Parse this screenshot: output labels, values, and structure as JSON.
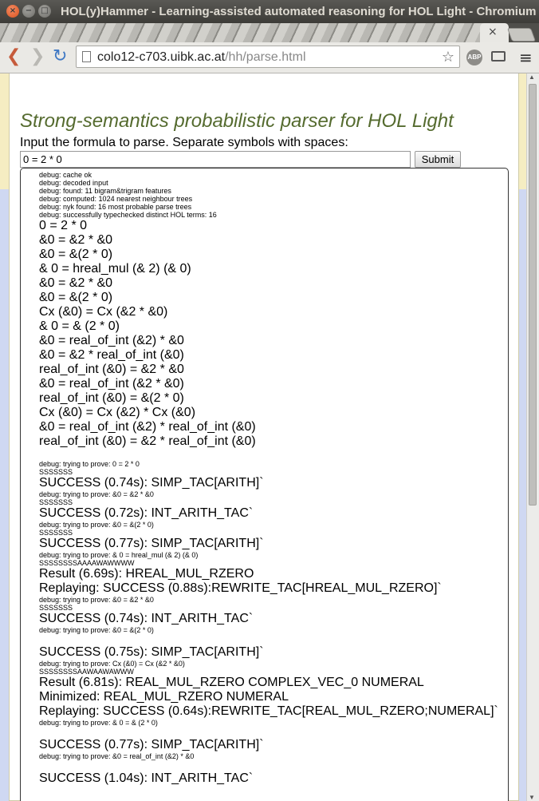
{
  "window": {
    "title": "HOL(y)Hammer - Learning-assisted automated reasoning for HOL Light - Chromium"
  },
  "tab": {
    "close_glyph": "×"
  },
  "toolbar": {
    "back_glyph": "❮",
    "forward_glyph": "❯",
    "reload_glyph": "↻",
    "url_host": "colo12-c703.uibk.ac.at",
    "url_path": "/hh/parse.html",
    "star_glyph": "☆",
    "abp_label": "ABP",
    "menu_glyph": "≡"
  },
  "page": {
    "heading": "Strong-semantics probabilistic parser for HOL Light",
    "instructions": "Input the formula to parse. Separate symbols with spaces:",
    "input_value": "0 = 2 * 0",
    "submit_label": "Submit"
  },
  "output_lines": [
    {
      "t": "debug: cache ok",
      "k": "dbg"
    },
    {
      "t": "debug: decoded input",
      "k": "dbg"
    },
    {
      "t": "debug: found: 11 bigram&trigram features",
      "k": "dbg"
    },
    {
      "t": "debug: computed: 1024 nearest neighbour trees",
      "k": "dbg"
    },
    {
      "t": "debug: nyk found: 16 most probable parse trees",
      "k": "dbg"
    },
    {
      "t": "debug: successfully typechecked distinct HOL terms: 16",
      "k": "dbg"
    },
    {
      "t": "0 = 2 * 0",
      "k": "big"
    },
    {
      "t": "&0 = &2 * &0",
      "k": "big"
    },
    {
      "t": "&0 = &(2 * 0)",
      "k": "big"
    },
    {
      "t": "& 0 = hreal_mul (& 2) (& 0)",
      "k": "big"
    },
    {
      "t": "&0 = &2 * &0",
      "k": "big"
    },
    {
      "t": "&0 = &(2 * 0)",
      "k": "big"
    },
    {
      "t": "Cx (&0) = Cx (&2 * &0)",
      "k": "big"
    },
    {
      "t": "& 0 = & (2 * 0)",
      "k": "big"
    },
    {
      "t": "&0 = real_of_int (&2) * &0",
      "k": "big"
    },
    {
      "t": "&0 = &2 * real_of_int (&0)",
      "k": "big"
    },
    {
      "t": "real_of_int (&0) = &2 * &0",
      "k": "big"
    },
    {
      "t": "&0 = real_of_int (&2 * &0)",
      "k": "big"
    },
    {
      "t": "real_of_int (&0) = &(2 * 0)",
      "k": "big"
    },
    {
      "t": "Cx (&0) = Cx (&2) * Cx (&0)",
      "k": "big"
    },
    {
      "t": "&0 = real_of_int (&2) * real_of_int (&0)",
      "k": "big"
    },
    {
      "t": "real_of_int (&0) = &2 * real_of_int (&0)",
      "k": "big"
    },
    {
      "t": "",
      "k": "gap"
    },
    {
      "t": "debug: trying to prove: 0 = 2 * 0",
      "k": "dbg"
    },
    {
      "t": "SSSSSSS",
      "k": "dbg"
    },
    {
      "t": "SUCCESS (0.74s): SIMP_TAC[ARITH]`",
      "k": "big"
    },
    {
      "t": "debug: trying to prove: &0 = &2 * &0",
      "k": "dbg"
    },
    {
      "t": "SSSSSSS",
      "k": "dbg"
    },
    {
      "t": "SUCCESS (0.72s): INT_ARITH_TAC`",
      "k": "big"
    },
    {
      "t": "debug: trying to prove: &0 = &(2 * 0)",
      "k": "dbg"
    },
    {
      "t": "SSSSSSS",
      "k": "dbg"
    },
    {
      "t": "SUCCESS (0.77s): SIMP_TAC[ARITH]`",
      "k": "big"
    },
    {
      "t": "debug: trying to prove: & 0 = hreal_mul (& 2) (& 0)",
      "k": "dbg"
    },
    {
      "t": "SSSSSSSSAAAAWAWWWW",
      "k": "dbg"
    },
    {
      "t": "Result (6.69s): HREAL_MUL_RZERO",
      "k": "big"
    },
    {
      "t": "Replaying: SUCCESS (0.88s):REWRITE_TAC[HREAL_MUL_RZERO]`",
      "k": "big"
    },
    {
      "t": "debug: trying to prove: &0 = &2 * &0",
      "k": "dbg"
    },
    {
      "t": "SSSSSSS",
      "k": "dbg"
    },
    {
      "t": "SUCCESS (0.74s): INT_ARITH_TAC`",
      "k": "big"
    },
    {
      "t": "debug: trying to prove: &0 = &(2 * 0)",
      "k": "dbg"
    },
    {
      "t": "",
      "k": "gap"
    },
    {
      "t": "SUCCESS (0.75s): SIMP_TAC[ARITH]`",
      "k": "big"
    },
    {
      "t": "debug: trying to prove: Cx (&0) = Cx (&2 * &0)",
      "k": "dbg"
    },
    {
      "t": "SSSSSSSSAAWAAWAWWW",
      "k": "dbg"
    },
    {
      "t": "Result (6.81s): REAL_MUL_RZERO COMPLEX_VEC_0 NUMERAL",
      "k": "big"
    },
    {
      "t": "Minimized: REAL_MUL_RZERO NUMERAL",
      "k": "big"
    },
    {
      "t": "Replaying: SUCCESS (0.64s):REWRITE_TAC[REAL_MUL_RZERO;NUMERAL]`",
      "k": "big"
    },
    {
      "t": "debug: trying to prove: & 0 = & (2 * 0)",
      "k": "dbg"
    },
    {
      "t": "",
      "k": "gap"
    },
    {
      "t": "SUCCESS (0.77s): SIMP_TAC[ARITH]`",
      "k": "big"
    },
    {
      "t": "debug: trying to prove: &0 = real_of_int (&2) * &0",
      "k": "dbg"
    },
    {
      "t": "",
      "k": "gap"
    },
    {
      "t": "SUCCESS (1.04s): INT_ARITH_TAC`",
      "k": "big"
    }
  ]
}
